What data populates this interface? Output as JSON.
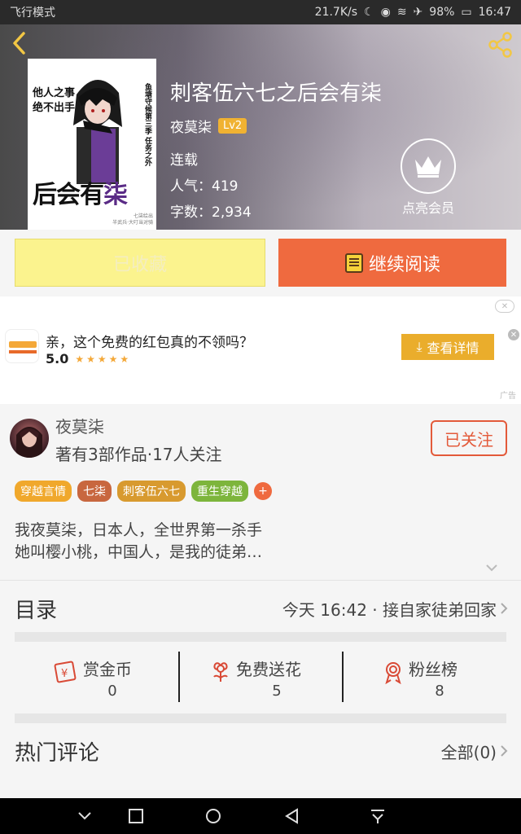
{
  "status_bar": {
    "left": "飞行模式",
    "net_speed": "21.7K/s",
    "battery": "98%",
    "time": "16:47"
  },
  "book": {
    "title": "刺客伍六七之后会有柒",
    "author": "夜莫柒",
    "level": "Lv2",
    "status": "连载",
    "popularity": "人气：419",
    "word_count": "字数：2,934",
    "cover": {
      "t1_line1": "他人之事",
      "t1_line2": "绝不出手",
      "t2": "鱼塘守候第三季 任务之外",
      "big_a": "后会有",
      "big_b": "柒",
      "small_line1": "七柒绘出",
      "small_line2": "半武兵·大叮当对骑"
    }
  },
  "vip": {
    "label": "点亮会员"
  },
  "actions": {
    "favorite_label": "已收藏",
    "read_label": "继续阅读"
  },
  "ad": {
    "text": "亲，这个免费的红包真的不领吗？",
    "rating": "5.0",
    "stars": "★★★★★",
    "button_label": "查看详情",
    "tag": "广告",
    "close_label": "✕"
  },
  "author_info": {
    "name": "夜莫柒",
    "stats": "著有3部作品·17人关注",
    "follow_label": "已关注",
    "tags": [
      {
        "label": "穿越言情",
        "color": "#f0a82c"
      },
      {
        "label": "七柒",
        "color": "#c8673f"
      },
      {
        "label": "刺客伍六七",
        "color": "#d89a2f"
      },
      {
        "label": "重生穿越",
        "color": "#7db53c"
      }
    ],
    "tag_add": "+",
    "desc_line1": "我夜莫柒，日本人，全世界第一杀手",
    "desc_line2": "她叫樱小桃，中国人，是我的徒弟…"
  },
  "catalog": {
    "title": "目录",
    "latest": "今天 16:42 · 接自家徒弟回家"
  },
  "stats": [
    {
      "label": "赏金币",
      "value": "0",
      "icon": "coin-envelope-icon"
    },
    {
      "label": "免费送花",
      "value": "5",
      "icon": "flower-icon"
    },
    {
      "label": "粉丝榜",
      "value": "8",
      "icon": "medal-icon"
    }
  ],
  "comments": {
    "title": "热门评论",
    "all_label": "全部(0)"
  },
  "colors": {
    "accent": "#ef6a3f",
    "favorite_bg": "#fbf38e",
    "lv_badge": "#f0b232",
    "ad_button": "#eaad2c"
  }
}
